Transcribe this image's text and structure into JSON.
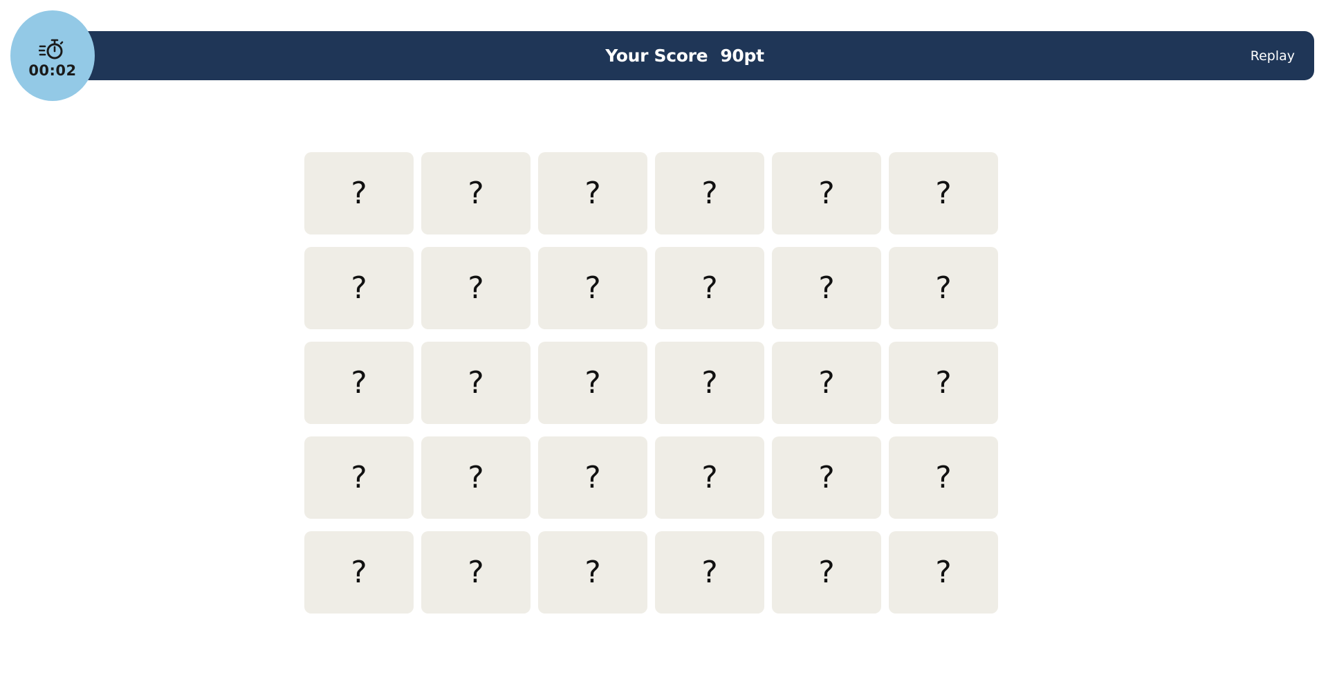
{
  "timer": {
    "icon": "stopwatch-icon",
    "value": "00:02"
  },
  "header": {
    "score_label": "Your Score",
    "score_value": "90pt",
    "replay_label": "Replay",
    "bar_color": "#1f3657"
  },
  "board": {
    "rows": 5,
    "columns": 6,
    "card_back_symbol": "?",
    "cards": [
      "?",
      "?",
      "?",
      "?",
      "?",
      "?",
      "?",
      "?",
      "?",
      "?",
      "?",
      "?",
      "?",
      "?",
      "?",
      "?",
      "?",
      "?",
      "?",
      "?",
      "?",
      "?",
      "?",
      "?",
      "?",
      "?",
      "?",
      "?",
      "?",
      "?"
    ]
  }
}
